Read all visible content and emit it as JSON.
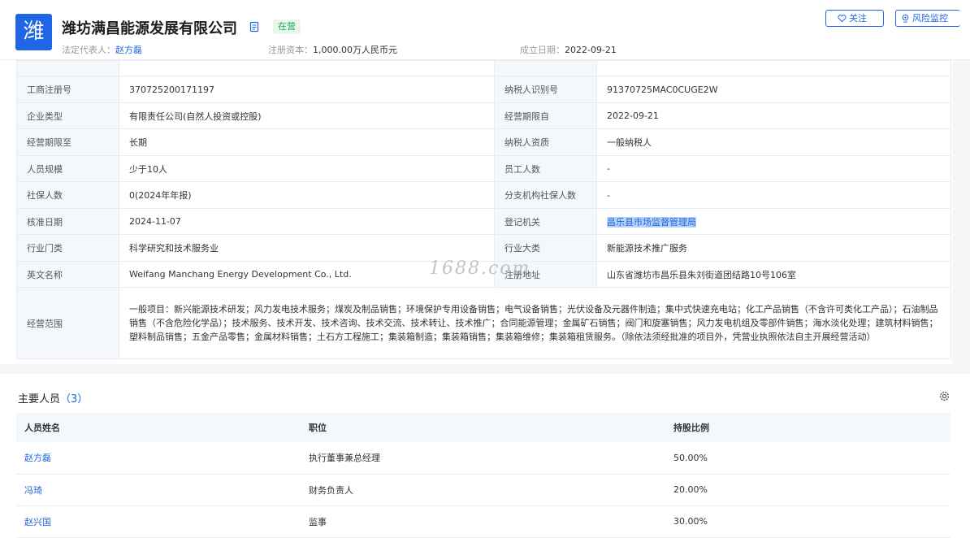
{
  "company": {
    "logo_char": "潍",
    "name": "潍坊满昌能源发展有限公司",
    "status": "在营",
    "legal_rep_label": "法定代表人：",
    "legal_rep": "赵方磊",
    "capital_label": "注册资本：",
    "capital": "1,000.00万人民币元",
    "founded_label": "成立日期：",
    "founded": "2022-09-21",
    "follow_label": "关注",
    "risk_label": "风险监控"
  },
  "info_rows": [
    {
      "k1": "工商注册号",
      "v1": "370725200171197",
      "k2": "纳税人识别号",
      "v2": "91370725MAC0CUGE2W"
    },
    {
      "k1": "企业类型",
      "v1": "有限责任公司(自然人投资或控股)",
      "k2": "经营期限自",
      "v2": "2022-09-21"
    },
    {
      "k1": "经营期限至",
      "v1": "长期",
      "k2": "纳税人资质",
      "v2": "一般纳税人"
    },
    {
      "k1": "人员规模",
      "v1": "少于10人",
      "k2": "员工人数",
      "v2": "-"
    },
    {
      "k1": "社保人数",
      "v1": "0(2024年年报)",
      "k2": "分支机构社保人数",
      "v2": "-"
    },
    {
      "k1": "核准日期",
      "v1": "2024-11-07",
      "k2": "登记机关",
      "v2": "昌乐县市场监督管理局"
    },
    {
      "k1": "行业门类",
      "v1": "科学研究和技术服务业",
      "k2": "行业大类",
      "v2": "新能源技术推广服务"
    },
    {
      "k1": "英文名称",
      "v1": "Weifang Manchang Energy Development Co., Ltd.",
      "k2": "注册地址",
      "v2": "山东省潍坊市昌乐县朱刘街道团结路10号106室"
    }
  ],
  "scope": {
    "label": "经营范围",
    "text": "一般项目：新兴能源技术研发；风力发电技术服务；煤炭及制品销售；环境保护专用设备销售；电气设备销售；光伏设备及元器件制造；集中式快速充电站；化工产品销售（不含许可类化工产品）；石油制品销售（不含危险化学品）；技术服务、技术开发、技术咨询、技术交流、技术转让、技术推广；合同能源管理；金属矿石销售；阀门和旋塞销售；风力发电机组及零部件销售；海水淡化处理；建筑材料销售；塑料制品销售；五金产品零售；金属材料销售；土石方工程施工；集装箱制造；集装箱销售；集装箱维修；集装箱租赁服务。（除依法须经批准的项目外，凭营业执照依法自主开展经营活动）"
  },
  "watermark": "1688.com",
  "people": {
    "title": "主要人员",
    "count": "（3）",
    "headers": [
      "人员姓名",
      "职位",
      "持股比例"
    ],
    "rows": [
      {
        "name": "赵方磊",
        "position": "执行董事兼总经理",
        "share": "50.00%"
      },
      {
        "name": "冯琦",
        "position": "财务负责人",
        "share": "20.00%"
      },
      {
        "name": "赵兴国",
        "position": "监事",
        "share": "30.00%"
      }
    ]
  },
  "colors": {
    "brand": "#1f66e5",
    "status_green": "#1aa85a",
    "label_bg": "#f4f7fb"
  }
}
